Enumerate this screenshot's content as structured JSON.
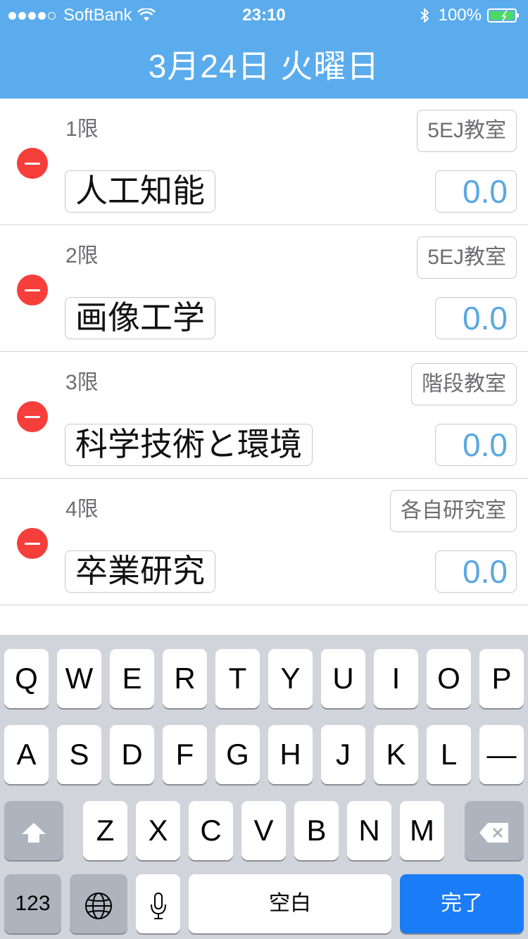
{
  "status_bar": {
    "carrier": "SoftBank",
    "time": "23:10",
    "battery": "100%",
    "icons": [
      "signal-dots",
      "wifi-icon",
      "bluetooth-icon",
      "battery-icon"
    ]
  },
  "header": {
    "title": "3月24日 火曜日",
    "background_color": "#5aacec"
  },
  "rows": [
    {
      "period": "1限",
      "room": "5EJ教室",
      "subject": "人工知能",
      "score": "0.0"
    },
    {
      "period": "2限",
      "room": "5EJ教室",
      "subject": "画像工学",
      "score": "0.0"
    },
    {
      "period": "3限",
      "room": "階段教室",
      "subject": "科学技術と環境",
      "score": "0.0"
    },
    {
      "period": "4限",
      "room": "各自研究室",
      "subject": "卒業研究",
      "score": "0.0"
    }
  ],
  "keyboard": {
    "row1": [
      "Q",
      "W",
      "E",
      "R",
      "T",
      "Y",
      "U",
      "I",
      "O",
      "P"
    ],
    "row2": [
      "A",
      "S",
      "D",
      "F",
      "G",
      "H",
      "J",
      "K",
      "L",
      "—"
    ],
    "row3": [
      "Z",
      "X",
      "C",
      "V",
      "B",
      "N",
      "M"
    ],
    "numbers_label": "123",
    "space_label": "空白",
    "return_label": "完了",
    "accent_color": "#1a7cf6"
  }
}
